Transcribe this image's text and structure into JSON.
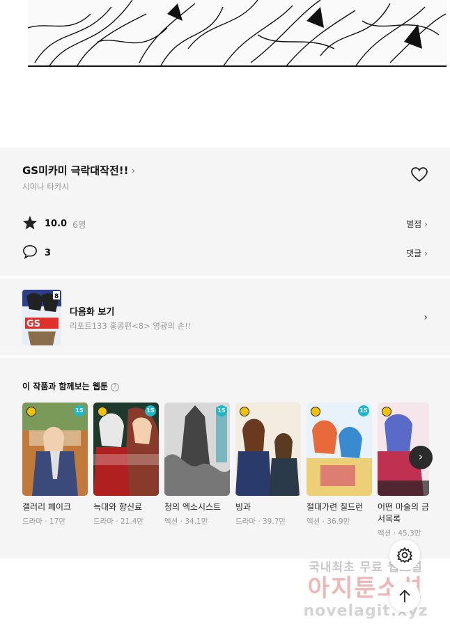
{
  "work": {
    "title": "GS미카미 극락대작전!!",
    "title_chevron": "›",
    "author": "시이나 타카시"
  },
  "stats": {
    "rating": "10.0",
    "rating_count": "6명",
    "rating_link": "별점",
    "comment_count": "3",
    "comment_link": "댓글",
    "chevron": "›"
  },
  "next_episode": {
    "title": "다음화 보기",
    "subtitle": "리포트133 홍콩편<8> 영광의 손!!",
    "arrow": "›"
  },
  "recommendations": {
    "heading": "이 작품과 함께보는 웹툰",
    "help_glyph": "?",
    "items": [
      {
        "title": "갤러리 페이크",
        "meta": "드라마 · 17만",
        "age": "15"
      },
      {
        "title": "늑대와 향신료",
        "meta": "드라마 · 21.4만",
        "age": "15"
      },
      {
        "title": "청의 엑소시스트",
        "meta": "액션 · 34.1만",
        "age": "15"
      },
      {
        "title": "빙과",
        "meta": "드라마 · 39.7만",
        "age": ""
      },
      {
        "title": "절대가련 칠드런",
        "meta": "액션 · 36.9만",
        "age": "15"
      },
      {
        "title": "어떤 마술의 금서목록",
        "meta": "액션 · 45.3만",
        "age": ""
      }
    ],
    "next_glyph": "›"
  },
  "watermark": {
    "line1": "국내최초 무료 웹소설",
    "line2": "아지툰소설",
    "line3": "novelagit.xyz"
  },
  "colors": {
    "panel_bg": "#f5f5f5",
    "age_badge": "#1fb8c8",
    "clock_badge": "#f2c200"
  },
  "icons": {
    "heart": "heart-icon",
    "star": "star-icon",
    "comment": "comment-icon",
    "gear": "gear-icon",
    "scroll_top": "arrow-up-icon"
  }
}
